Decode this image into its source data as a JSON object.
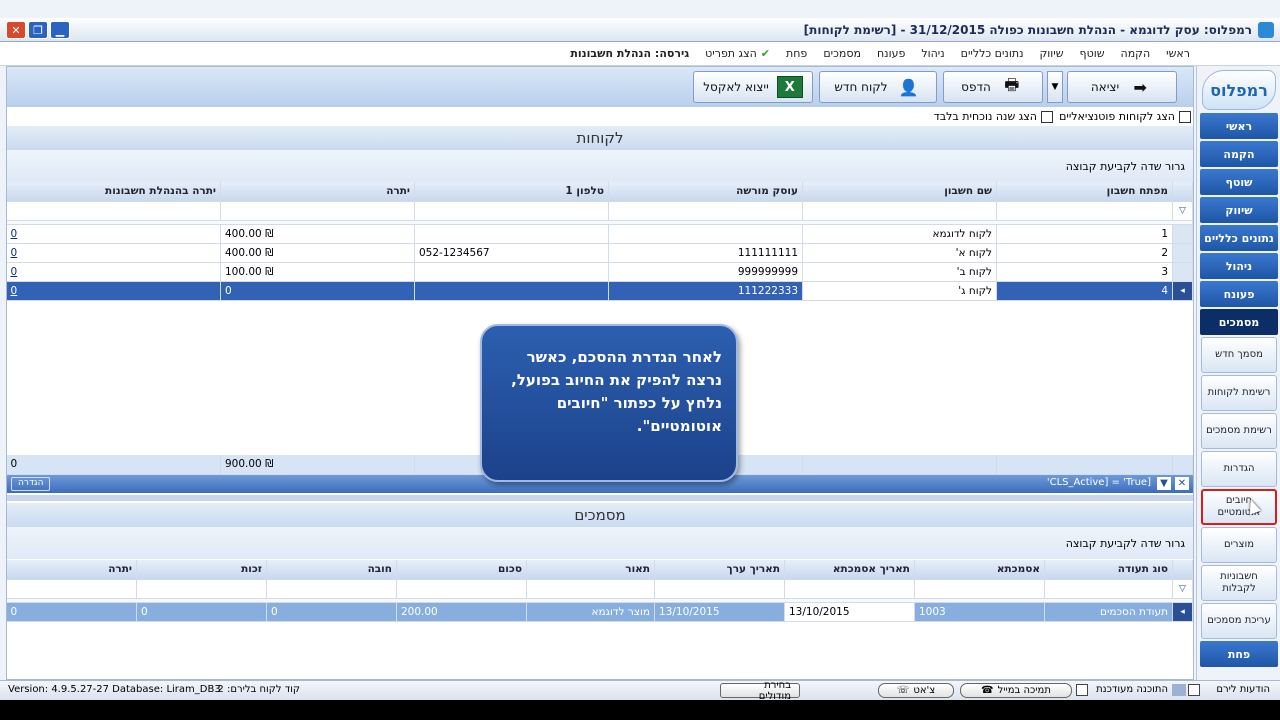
{
  "titlebar": {
    "title": "רמפלוס: עסק לדוגמא - הנהלת חשבונות כפולה   31/12/2015 - [רשימת לקוחות]"
  },
  "menu": {
    "items": [
      "ראשי",
      "הקמה",
      "שוטף",
      "שיווק",
      "נתונים כלליים",
      "ניהול",
      "פעונח",
      "מסמכים",
      "פחת",
      "הצג תפריט"
    ],
    "version_label": "גירסה: הנהלת חשבונות"
  },
  "logo": {
    "text": "רמפלוס"
  },
  "nav": {
    "top_items": [
      "ראשי",
      "הקמה",
      "שוטף",
      "שיווק",
      "נתונים כלליים",
      "ניהול",
      "פעונח",
      "מסמכים"
    ],
    "sub_items": [
      "מסמך חדש",
      "רשימת לקוחות",
      "רשימת מסמכים",
      "הגדרות",
      "חיובים אוטומטיים",
      "מוצרים",
      "חשבוניות לקבלות",
      "עריכת מסמכים"
    ],
    "bottom_item": "פחת"
  },
  "toolbar": {
    "exit_label": "יציאה",
    "print_label": "הדפס",
    "new_customer_label": "לקוח חדש",
    "export_excel_label": "ייצוא לאקסל"
  },
  "options": {
    "show_potential": "הצג לקוחות פוטנציאליים",
    "show_current_year": "הצג שנה נוכחית בלבד"
  },
  "customers": {
    "title": "לקוחות",
    "group_hint": "גרור שדה לקביעת קבוצה",
    "columns": [
      "מפתח חשבון",
      "שם חשבון",
      "עוסק מורשה",
      "טלפון 1",
      "יתרה",
      "יתרה בהנהלת חשבונות"
    ],
    "rows": [
      [
        "1",
        "לקוח לדוגמא",
        "",
        "",
        "400.00 ₪",
        "0"
      ],
      [
        "2",
        "לקוח א'",
        "111111111",
        "052-1234567",
        "400.00 ₪",
        "0"
      ],
      [
        "3",
        "לקוח ב'",
        "999999999",
        "",
        "100.00 ₪",
        "0"
      ],
      [
        "4",
        "לקוח ג'",
        "111222333",
        "",
        "0",
        "0"
      ]
    ],
    "total_balance": "900.00 ₪",
    "total_bookkeeping": "0",
    "filter_text": "'CLS_Active] = 'True]",
    "filter_button": "הגדרה"
  },
  "documents": {
    "title": "מסמכים",
    "group_hint": "גרור שדה לקביעת קבוצה",
    "columns": [
      "סוג תעודה",
      "אסמכתא",
      "תאריך אסמכתא",
      "תאריך ערך",
      "תאור",
      "סכום",
      "חובה",
      "זכות",
      "יתרה"
    ],
    "rows": [
      [
        "תעודת הסכמים",
        "1003",
        "13/10/2015",
        "13/10/2015",
        "מוצר לדוגמא",
        "200.00",
        "0",
        "0",
        "0"
      ]
    ]
  },
  "callout": {
    "text": "לאחר הגדרת ההסכם, כאשר נרצה להפיק את החיוב בפועל, נלחץ על כפתור \"חיובים אוטומטיים\"."
  },
  "statusbar": {
    "messages": "הודעות לירם",
    "software_update": "התוכנה מעודכנת",
    "remote_support": "תמיכה במייל",
    "chat": "צ'אט",
    "modules": "בחירת מודולים",
    "user_code": "קוד לקוח בלירם: 2",
    "version": "Version: 4.9.5.27-27  Database: Liram_DB3"
  },
  "colors": {
    "accent": "#1f56a6",
    "active_row": "#3262b6",
    "highlight_border": "#d81d1d"
  }
}
